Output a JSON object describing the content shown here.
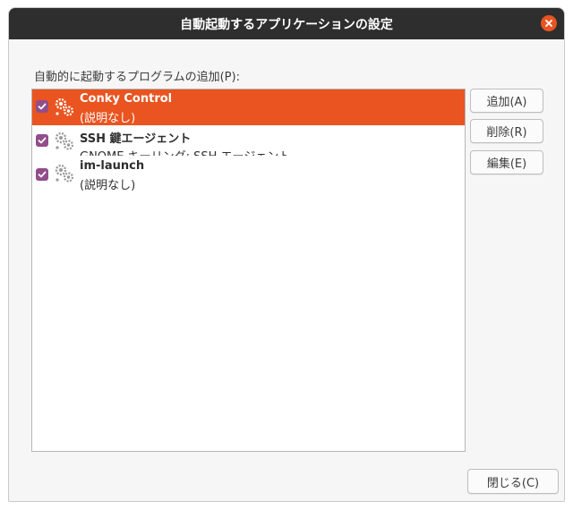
{
  "window": {
    "title": "自動起動するアプリケーションの設定"
  },
  "section_label": "自動的に起動するプログラムの追加(P):",
  "startup_items": [
    {
      "name": "Conky Control",
      "description": "(説明なし)",
      "enabled": true,
      "selected": true,
      "icon": "gears-icon"
    },
    {
      "name": "SSH 鍵エージェント",
      "description": "GNOME キーリング: SSH エージェント",
      "enabled": true,
      "selected": false,
      "icon": "gears-icon"
    },
    {
      "name": "im-launch",
      "description": "(説明なし)",
      "enabled": true,
      "selected": false,
      "icon": "gears-icon"
    }
  ],
  "buttons": {
    "add": "追加(A)",
    "remove": "削除(R)",
    "edit": "編集(E)",
    "close": "閉じる(C)"
  },
  "colors": {
    "accent": "#e95420",
    "titlebar": "#2e2e2e",
    "checkbox": "#924d8b"
  }
}
